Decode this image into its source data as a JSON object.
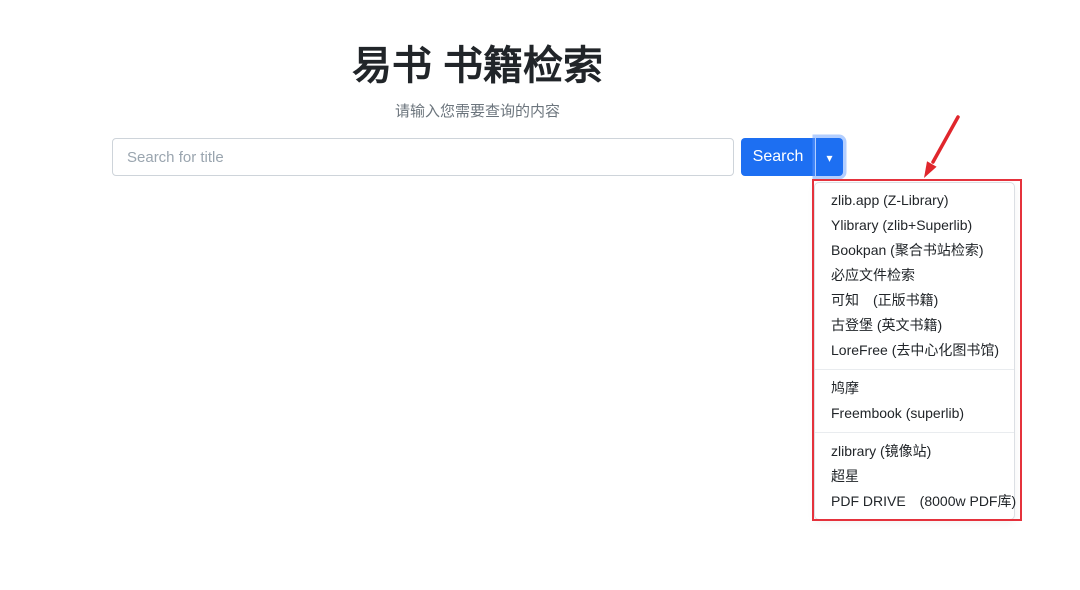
{
  "page": {
    "title": "易书 书籍检索",
    "subtitle": "请输入您需要查询的内容"
  },
  "search": {
    "placeholder": "Search for title",
    "button_label": "Search",
    "caret_icon": "▾"
  },
  "menu": {
    "groups": [
      {
        "items": [
          "zlib.app (Z-Library)",
          "Ylibrary (zlib+Superlib)",
          "Bookpan (聚合书站检索)",
          "必应文件检索",
          "可知　(正版书籍)",
          "古登堡 (英文书籍)",
          "LoreFree (去中心化图书馆)"
        ]
      },
      {
        "items": [
          "鸠摩",
          "Freembook (superlib)"
        ]
      },
      {
        "items": [
          "zlibrary (镜像站)",
          "超星",
          "PDF DRIVE　(8000w PDF库)"
        ]
      }
    ]
  },
  "colors": {
    "accent_blue": "#1d6ff2",
    "annotation_red": "#e5323c",
    "text_dark": "#212529",
    "text_muted": "#6c757d"
  }
}
